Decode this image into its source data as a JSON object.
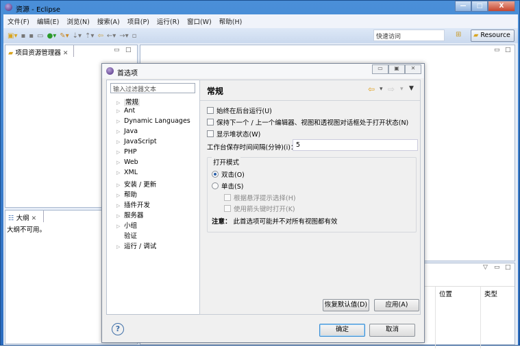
{
  "window": {
    "title": "资源 - Eclipse",
    "min": "—",
    "max": "□",
    "close": "X"
  },
  "menu": [
    "文件(F)",
    "编辑(E)",
    "浏览(N)",
    "搜索(A)",
    "项目(P)",
    "运行(R)",
    "窗口(W)",
    "帮助(H)"
  ],
  "toolbar": {
    "quick_access_placeholder": "快速访问",
    "perspective": "Resource"
  },
  "project_explorer": {
    "tab": "项目资源管理器"
  },
  "outline": {
    "tab": "大纲",
    "message": "大纲不可用。"
  },
  "bottom_panel": {
    "columns": [
      "位置",
      "类型"
    ]
  },
  "dialog": {
    "title": "首选项",
    "filter_placeholder": "输入过滤器文本",
    "tree": [
      {
        "label": "常规",
        "expandable": true,
        "selected": true
      },
      {
        "label": "Ant",
        "expandable": true
      },
      {
        "label": "Dynamic Languages",
        "expandable": true
      },
      {
        "label": "Java",
        "expandable": true
      },
      {
        "label": "JavaScript",
        "expandable": true
      },
      {
        "label": "PHP",
        "expandable": true
      },
      {
        "label": "Web",
        "expandable": true
      },
      {
        "label": "XML",
        "expandable": true
      },
      {
        "label": "安装 / 更新",
        "expandable": true
      },
      {
        "label": "帮助",
        "expandable": true
      },
      {
        "label": "插件开发",
        "expandable": true
      },
      {
        "label": "服务器",
        "expandable": true
      },
      {
        "label": "小组",
        "expandable": true
      },
      {
        "label": "验证",
        "expandable": false
      },
      {
        "label": "运行 / 调试",
        "expandable": true
      }
    ],
    "page_title": "常规",
    "options": {
      "run_in_background": {
        "label": "始终在后台运行(U)",
        "checked": false
      },
      "keep_next_prev": {
        "label": "保持下一个 / 上一个编辑器、视图和透视图对话框处于打开状态(N)",
        "checked": false
      },
      "show_heap": {
        "label": "显示堆状态(W)",
        "checked": false
      },
      "save_interval_label": "工作台保存时间间隔(分钟)(i)：",
      "save_interval_value": "5"
    },
    "open_mode": {
      "legend": "打开模式",
      "double_click": {
        "label": "双击(O)",
        "selected": true
      },
      "single_click": {
        "label": "单击(S)",
        "selected": false
      },
      "hover_select": {
        "label": "根据悬浮提示选择(H)",
        "checked": false
      },
      "arrow_open": {
        "label": "使用箭头键时打开(K)",
        "checked": false
      },
      "note_label": "注意：",
      "note_text": "此首选项可能并不对所有视图都有效"
    },
    "buttons": {
      "restore_defaults": "恢复默认值(D)",
      "apply": "应用(A)",
      "ok": "确定",
      "cancel": "取消",
      "help": "?"
    }
  }
}
